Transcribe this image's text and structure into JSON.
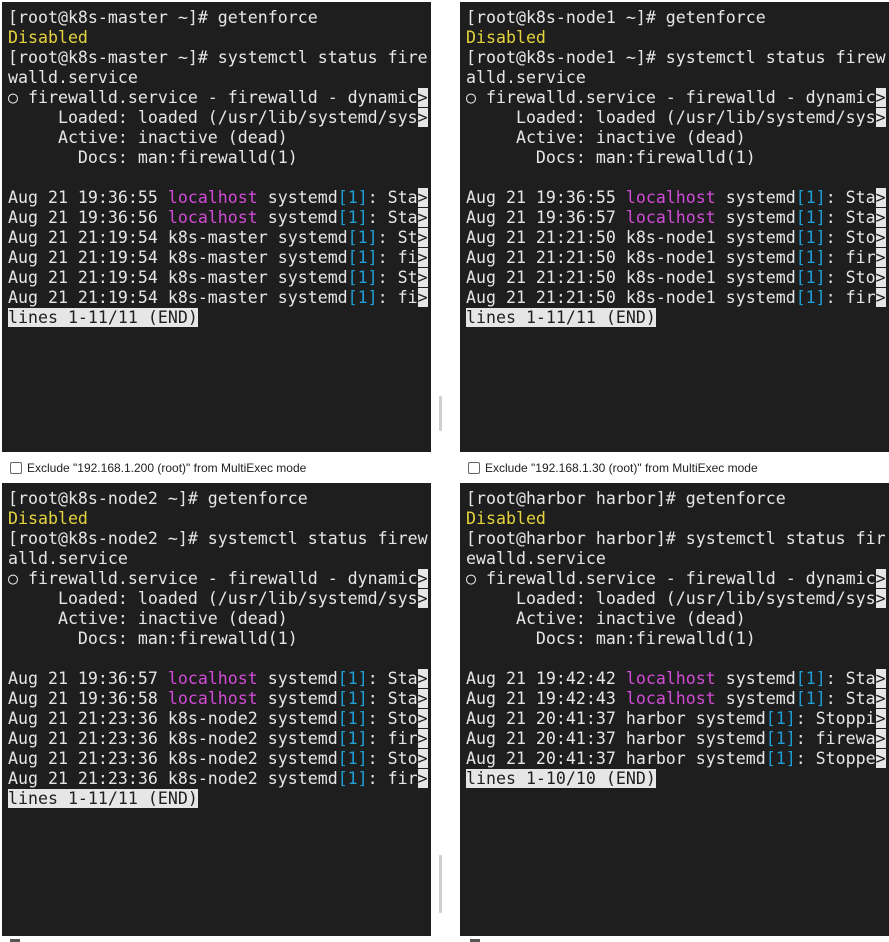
{
  "panes": [
    {
      "id": "master",
      "lines": [
        [
          {
            "t": "[root@k8s-master ~]# getenforce"
          }
        ],
        [
          {
            "t": "Disabled",
            "c": "yellow"
          }
        ],
        [
          {
            "t": "[root@k8s-master ~]# systemctl status fire"
          }
        ],
        [
          {
            "t": "walld.service"
          }
        ],
        [
          {
            "t": "○ firewalld.service - firewalld - dynamic"
          },
          {
            "t": ">",
            "c": "trunc"
          }
        ],
        [
          {
            "t": "     Loaded: loaded (/usr/lib/systemd/sys"
          },
          {
            "t": ">",
            "c": "trunc"
          }
        ],
        [
          {
            "t": "     Active: inactive (dead)"
          }
        ],
        [
          {
            "t": "       Docs: man:firewalld(1)"
          }
        ],
        [
          {
            "t": ""
          }
        ],
        [
          {
            "t": "Aug 21 19:36:55 "
          },
          {
            "t": "localhost",
            "c": "magenta"
          },
          {
            "t": " systemd"
          },
          {
            "t": "[1]",
            "c": "cyan"
          },
          {
            "t": ": Sta"
          },
          {
            "t": ">",
            "c": "trunc"
          }
        ],
        [
          {
            "t": "Aug 21 19:36:56 "
          },
          {
            "t": "localhost",
            "c": "magenta"
          },
          {
            "t": " systemd"
          },
          {
            "t": "[1]",
            "c": "cyan"
          },
          {
            "t": ": Sta"
          },
          {
            "t": ">",
            "c": "trunc"
          }
        ],
        [
          {
            "t": "Aug 21 21:19:54 k8s-master systemd"
          },
          {
            "t": "[1]",
            "c": "cyan"
          },
          {
            "t": ": St"
          },
          {
            "t": ">",
            "c": "trunc"
          }
        ],
        [
          {
            "t": "Aug 21 21:19:54 k8s-master systemd"
          },
          {
            "t": "[1]",
            "c": "cyan"
          },
          {
            "t": ": fi"
          },
          {
            "t": ">",
            "c": "trunc"
          }
        ],
        [
          {
            "t": "Aug 21 21:19:54 k8s-master systemd"
          },
          {
            "t": "[1]",
            "c": "cyan"
          },
          {
            "t": ": St"
          },
          {
            "t": ">",
            "c": "trunc"
          }
        ],
        [
          {
            "t": "Aug 21 21:19:54 k8s-master systemd"
          },
          {
            "t": "[1]",
            "c": "cyan"
          },
          {
            "t": ": fi"
          },
          {
            "t": ">",
            "c": "trunc"
          }
        ],
        [
          {
            "t": "lines 1-11/11 (END)",
            "c": "status"
          }
        ]
      ]
    },
    {
      "id": "node1",
      "lines": [
        [
          {
            "t": "[root@k8s-node1 ~]# getenforce"
          }
        ],
        [
          {
            "t": "Disabled",
            "c": "yellow"
          }
        ],
        [
          {
            "t": "[root@k8s-node1 ~]# systemctl status firew"
          }
        ],
        [
          {
            "t": "alld.service"
          }
        ],
        [
          {
            "t": "○ firewalld.service - firewalld - dynamic"
          },
          {
            "t": ">",
            "c": "trunc"
          }
        ],
        [
          {
            "t": "     Loaded: loaded (/usr/lib/systemd/sys"
          },
          {
            "t": ">",
            "c": "trunc"
          }
        ],
        [
          {
            "t": "     Active: inactive (dead)"
          }
        ],
        [
          {
            "t": "       Docs: man:firewalld(1)"
          }
        ],
        [
          {
            "t": ""
          }
        ],
        [
          {
            "t": "Aug 21 19:36:55 "
          },
          {
            "t": "localhost",
            "c": "magenta"
          },
          {
            "t": " systemd"
          },
          {
            "t": "[1]",
            "c": "cyan"
          },
          {
            "t": ": Sta"
          },
          {
            "t": ">",
            "c": "trunc"
          }
        ],
        [
          {
            "t": "Aug 21 19:36:57 "
          },
          {
            "t": "localhost",
            "c": "magenta"
          },
          {
            "t": " systemd"
          },
          {
            "t": "[1]",
            "c": "cyan"
          },
          {
            "t": ": Sta"
          },
          {
            "t": ">",
            "c": "trunc"
          }
        ],
        [
          {
            "t": "Aug 21 21:21:50 k8s-node1 systemd"
          },
          {
            "t": "[1]",
            "c": "cyan"
          },
          {
            "t": ": Sto"
          },
          {
            "t": ">",
            "c": "trunc"
          }
        ],
        [
          {
            "t": "Aug 21 21:21:50 k8s-node1 systemd"
          },
          {
            "t": "[1]",
            "c": "cyan"
          },
          {
            "t": ": fir"
          },
          {
            "t": ">",
            "c": "trunc"
          }
        ],
        [
          {
            "t": "Aug 21 21:21:50 k8s-node1 systemd"
          },
          {
            "t": "[1]",
            "c": "cyan"
          },
          {
            "t": ": Sto"
          },
          {
            "t": ">",
            "c": "trunc"
          }
        ],
        [
          {
            "t": "Aug 21 21:21:50 k8s-node1 systemd"
          },
          {
            "t": "[1]",
            "c": "cyan"
          },
          {
            "t": ": fir"
          },
          {
            "t": ">",
            "c": "trunc"
          }
        ],
        [
          {
            "t": "lines 1-11/11 (END)",
            "c": "status"
          }
        ]
      ]
    },
    {
      "id": "node2",
      "lines": [
        [
          {
            "t": "[root@k8s-node2 ~]# getenforce"
          }
        ],
        [
          {
            "t": "Disabled",
            "c": "yellow"
          }
        ],
        [
          {
            "t": "[root@k8s-node2 ~]# systemctl status firew"
          }
        ],
        [
          {
            "t": "alld.service"
          }
        ],
        [
          {
            "t": "○ firewalld.service - firewalld - dynamic"
          },
          {
            "t": ">",
            "c": "trunc"
          }
        ],
        [
          {
            "t": "     Loaded: loaded (/usr/lib/systemd/sys"
          },
          {
            "t": ">",
            "c": "trunc"
          }
        ],
        [
          {
            "t": "     Active: inactive (dead)"
          }
        ],
        [
          {
            "t": "       Docs: man:firewalld(1)"
          }
        ],
        [
          {
            "t": ""
          }
        ],
        [
          {
            "t": "Aug 21 19:36:57 "
          },
          {
            "t": "localhost",
            "c": "magenta"
          },
          {
            "t": " systemd"
          },
          {
            "t": "[1]",
            "c": "cyan"
          },
          {
            "t": ": Sta"
          },
          {
            "t": ">",
            "c": "trunc"
          }
        ],
        [
          {
            "t": "Aug 21 19:36:58 "
          },
          {
            "t": "localhost",
            "c": "magenta"
          },
          {
            "t": " systemd"
          },
          {
            "t": "[1]",
            "c": "cyan"
          },
          {
            "t": ": Sta"
          },
          {
            "t": ">",
            "c": "trunc"
          }
        ],
        [
          {
            "t": "Aug 21 21:23:36 k8s-node2 systemd"
          },
          {
            "t": "[1]",
            "c": "cyan"
          },
          {
            "t": ": Sto"
          },
          {
            "t": ">",
            "c": "trunc"
          }
        ],
        [
          {
            "t": "Aug 21 21:23:36 k8s-node2 systemd"
          },
          {
            "t": "[1]",
            "c": "cyan"
          },
          {
            "t": ": fir"
          },
          {
            "t": ">",
            "c": "trunc"
          }
        ],
        [
          {
            "t": "Aug 21 21:23:36 k8s-node2 systemd"
          },
          {
            "t": "[1]",
            "c": "cyan"
          },
          {
            "t": ": Sto"
          },
          {
            "t": ">",
            "c": "trunc"
          }
        ],
        [
          {
            "t": "Aug 21 21:23:36 k8s-node2 systemd"
          },
          {
            "t": "[1]",
            "c": "cyan"
          },
          {
            "t": ": fir"
          },
          {
            "t": ">",
            "c": "trunc"
          }
        ],
        [
          {
            "t": "lines 1-11/11 (END)",
            "c": "status"
          }
        ]
      ]
    },
    {
      "id": "harbor",
      "lines": [
        [
          {
            "t": "[root@harbor harbor]# getenforce"
          }
        ],
        [
          {
            "t": "Disabled",
            "c": "yellow"
          }
        ],
        [
          {
            "t": "[root@harbor harbor]# systemctl status fir"
          }
        ],
        [
          {
            "t": "ewalld.service"
          }
        ],
        [
          {
            "t": "○ firewalld.service - firewalld - dynamic"
          },
          {
            "t": ">",
            "c": "trunc"
          }
        ],
        [
          {
            "t": "     Loaded: loaded (/usr/lib/systemd/sys"
          },
          {
            "t": ">",
            "c": "trunc"
          }
        ],
        [
          {
            "t": "     Active: inactive (dead)"
          }
        ],
        [
          {
            "t": "       Docs: man:firewalld(1)"
          }
        ],
        [
          {
            "t": ""
          }
        ],
        [
          {
            "t": "Aug 21 19:42:42 "
          },
          {
            "t": "localhost",
            "c": "magenta"
          },
          {
            "t": " systemd"
          },
          {
            "t": "[1]",
            "c": "cyan"
          },
          {
            "t": ": Sta"
          },
          {
            "t": ">",
            "c": "trunc"
          }
        ],
        [
          {
            "t": "Aug 21 19:42:43 "
          },
          {
            "t": "localhost",
            "c": "magenta"
          },
          {
            "t": " systemd"
          },
          {
            "t": "[1]",
            "c": "cyan"
          },
          {
            "t": ": Sta"
          },
          {
            "t": ">",
            "c": "trunc"
          }
        ],
        [
          {
            "t": "Aug 21 20:41:37 harbor systemd"
          },
          {
            "t": "[1]",
            "c": "cyan"
          },
          {
            "t": ": Stoppi"
          },
          {
            "t": ">",
            "c": "trunc"
          }
        ],
        [
          {
            "t": "Aug 21 20:41:37 harbor systemd"
          },
          {
            "t": "[1]",
            "c": "cyan"
          },
          {
            "t": ": firewa"
          },
          {
            "t": ">",
            "c": "trunc"
          }
        ],
        [
          {
            "t": "Aug 21 20:41:37 harbor systemd"
          },
          {
            "t": "[1]",
            "c": "cyan"
          },
          {
            "t": ": Stoppe"
          },
          {
            "t": ">",
            "c": "trunc"
          }
        ],
        [
          {
            "t": "lines 1-10/10 (END)",
            "c": "status"
          }
        ]
      ]
    }
  ],
  "exclude_labels": {
    "left": "Exclude \"192.168.1.200 (root)\" from MultiExec mode",
    "right": "Exclude \"192.168.1.30 (root)\" from MultiExec mode"
  },
  "colors": {
    "terminal_bg": "#1e1e1e",
    "text": "#e6e6e6",
    "yellow": "#e5d43b",
    "magenta": "#d14bd6",
    "cyan": "#1f9ed6"
  }
}
